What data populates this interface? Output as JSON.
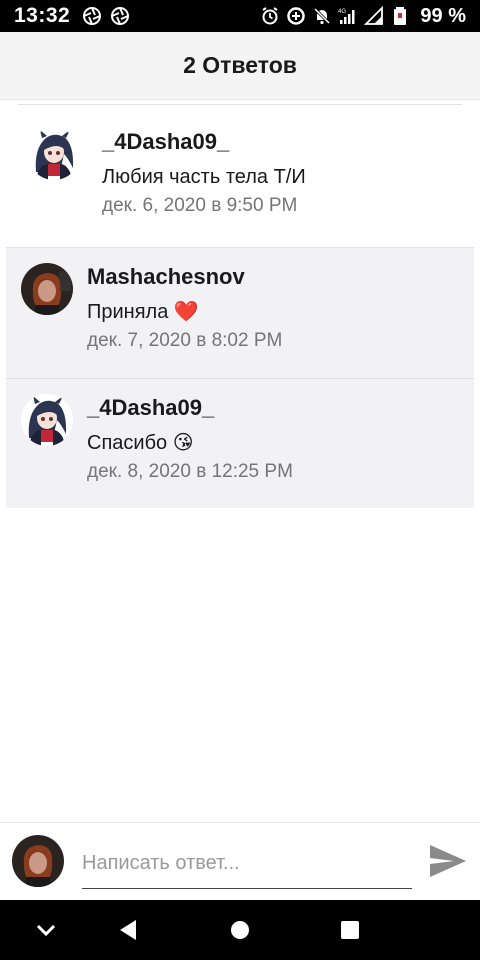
{
  "status_bar": {
    "time": "13:32",
    "battery": "99 %"
  },
  "header": {
    "title": "2 Ответов"
  },
  "replies": [
    {
      "username": "_4Dasha09_",
      "text": "Любия часть тела Т/И",
      "date": "дек. 6, 2020 в 9:50 PM",
      "avatar": "anime-avatar"
    },
    {
      "username": "Mashachesnov",
      "text": "Приняла ❤️",
      "date": "дек. 7, 2020 в 8:02 PM",
      "avatar": "photo-avatar"
    },
    {
      "username": "_4Dasha09_",
      "text": "Спасибо 😘",
      "date": "дек. 8, 2020 в 12:25 PM",
      "avatar": "anime-avatar"
    }
  ],
  "composer": {
    "placeholder": "Написать ответ..."
  },
  "colors": {
    "nested_bg": "#f2f2f4",
    "header_bg": "#f4f4f4",
    "date_gray": "#757575"
  }
}
